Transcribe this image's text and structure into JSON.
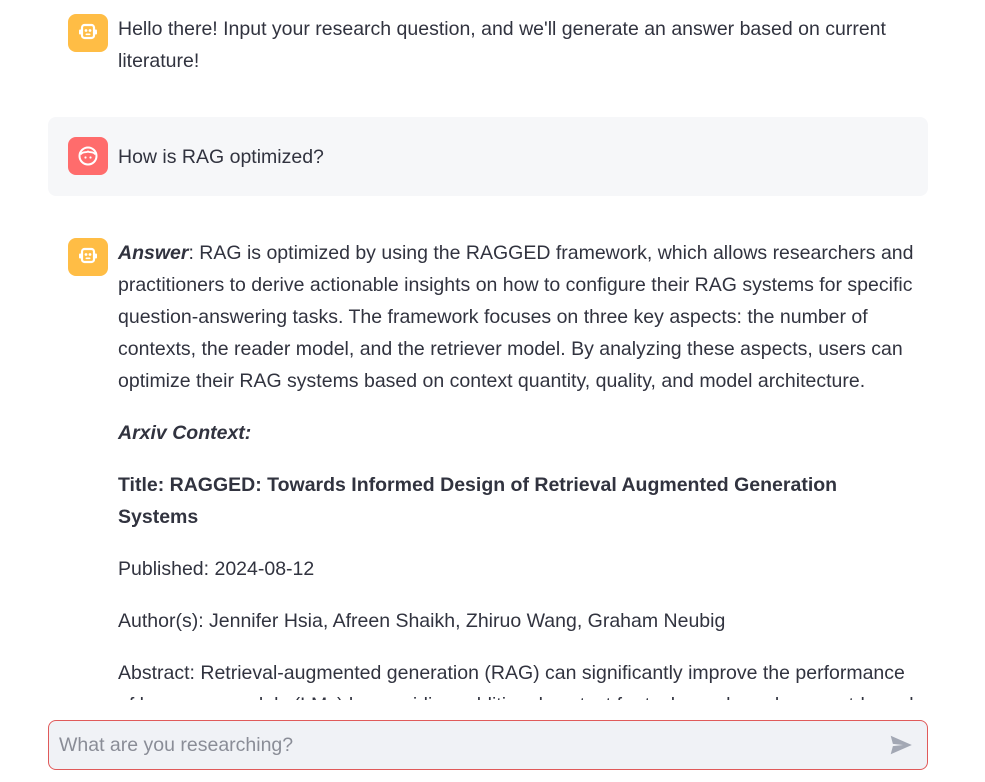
{
  "messages": [
    {
      "role": "assistant",
      "avatar_icon": "robot-icon",
      "text": "Hello there! Input your research question, and we'll generate an answer based on current literature!"
    },
    {
      "role": "user",
      "avatar_icon": "face-icon",
      "text": "How is RAG optimized?"
    },
    {
      "role": "assistant",
      "avatar_icon": "robot-icon",
      "answer_label": "Answer",
      "answer_text": ": RAG is optimized by using the RAGGED framework, which allows researchers and practitioners to derive actionable insights on how to configure their RAG systems for specific question-answering tasks. The framework focuses on three key aspects: the number of contexts, the reader model, and the retriever model. By analyzing these aspects, users can optimize their RAG systems based on context quantity, quality, and model architecture.",
      "context_heading": "Arxiv Context:",
      "paper_title": "Title: RAGGED: Towards Informed Design of Retrieval Augmented Generation Systems",
      "published": "Published: 2024-08-12",
      "authors": "Author(s): Jennifer Hsia, Afreen Shaikh, Zhiruo Wang, Graham Neubig",
      "abstract": "Abstract: Retrieval-augmented generation (RAG) can significantly improve the performance of language models (LMs) by providing additional context for tasks such as document-based question answering (DBQA). However, the effectiveness of RAG is highly dependent on its configuration."
    }
  ],
  "chat_input": {
    "placeholder": "What are you researching?",
    "value": ""
  },
  "colors": {
    "bot_avatar": "#ffbd45",
    "user_avatar": "#ff6c6c",
    "user_bubble": "#f6f7f9",
    "input_border": "#e05a5a",
    "input_bg": "#f0f2f6",
    "text": "#31333f"
  }
}
